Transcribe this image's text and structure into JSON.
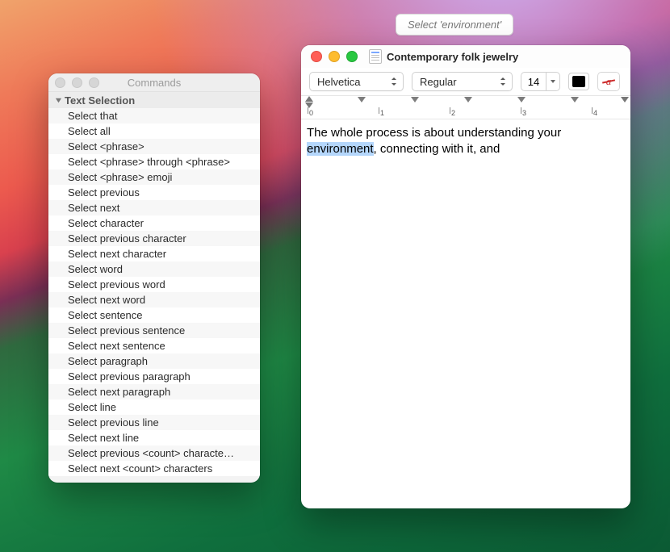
{
  "tooltip": {
    "text": "Select 'environment'"
  },
  "commands_window": {
    "title": "Commands",
    "section": "Text Selection",
    "items": [
      "Select that",
      "Select all",
      "Select <phrase>",
      "Select <phrase> through <phrase>",
      "Select <phrase> emoji",
      "Select previous",
      "Select next",
      "Select character",
      "Select previous character",
      "Select next character",
      "Select word",
      "Select previous word",
      "Select next word",
      "Select sentence",
      "Select previous sentence",
      "Select next sentence",
      "Select paragraph",
      "Select previous paragraph",
      "Select next paragraph",
      "Select line",
      "Select previous line",
      "Select next line",
      "Select previous <count> characte…",
      "Select next <count> characters"
    ]
  },
  "editor_window": {
    "title": "Contemporary folk jewelry",
    "toolbar": {
      "font_family": "Helvetica",
      "font_style": "Regular",
      "font_size": "14"
    },
    "ruler": {
      "labels": [
        "0",
        "1",
        "2",
        "3",
        "4"
      ]
    },
    "document": {
      "before_sel": "The whole process is about understanding your ",
      "selected": "environment",
      "after_sel": ", connecting with it, and"
    }
  }
}
